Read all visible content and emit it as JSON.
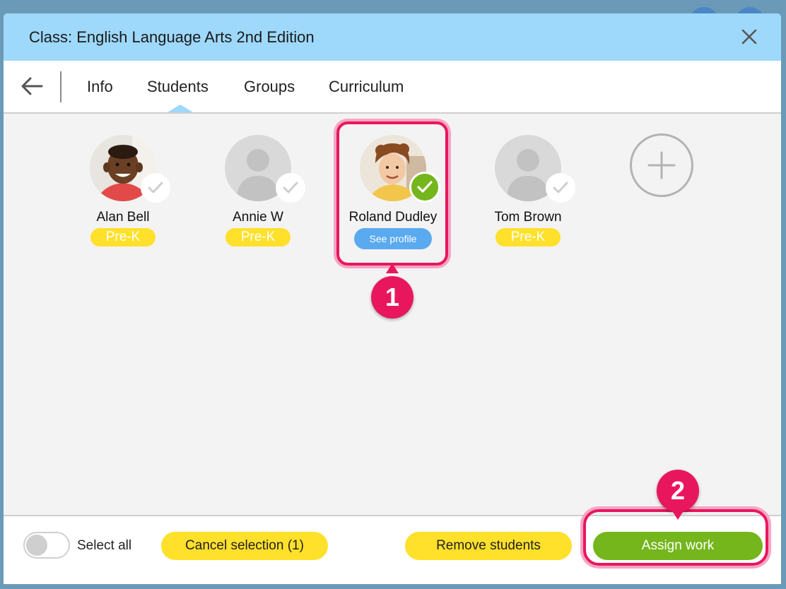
{
  "dialog": {
    "title": "Class: English Language Arts 2nd Edition"
  },
  "tabs": [
    {
      "label": "Info",
      "active": false
    },
    {
      "label": "Students",
      "active": true
    },
    {
      "label": "Groups",
      "active": false
    },
    {
      "label": "Curriculum",
      "active": false
    }
  ],
  "students": [
    {
      "name": "Alan Bell",
      "badge": "Pre-K",
      "selected": false
    },
    {
      "name": "Annie W",
      "badge": "Pre-K",
      "selected": false
    },
    {
      "name": "Roland Dudley",
      "action": "See profile",
      "selected": true
    },
    {
      "name": "Tom Brown",
      "badge": "Pre-K",
      "selected": false
    }
  ],
  "footer": {
    "select_all_label": "Select all",
    "cancel_label": "Cancel selection (1)",
    "remove_label": "Remove students",
    "assign_label": "Assign work"
  },
  "markers": {
    "one": "1",
    "two": "2"
  },
  "colors": {
    "title_bar": "#9ed8fb",
    "badge_yellow": "#ffe02b",
    "assign_green": "#74b61c",
    "highlight_pink": "#e8175d",
    "profile_blue": "#5aaaf0"
  }
}
